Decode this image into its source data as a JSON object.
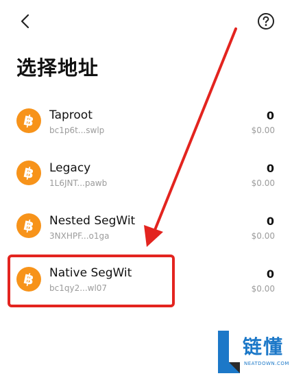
{
  "header": {
    "title": "选择地址"
  },
  "icons": {
    "back": "chevron-left-icon",
    "help": "question-circle-icon",
    "coin": "bitcoin-icon"
  },
  "colors": {
    "bitcoin": "#F7931A",
    "highlight": "#E3241F",
    "watermark": "#1C78C8"
  },
  "addresses": [
    {
      "name": "Taproot",
      "address": "bc1p6t...swlp",
      "balance": "0",
      "fiat": "$0.00"
    },
    {
      "name": "Legacy",
      "address": "1L6JNT...pawb",
      "balance": "0",
      "fiat": "$0.00"
    },
    {
      "name": "Nested SegWit",
      "address": "3NXHPF...o1ga",
      "balance": "0",
      "fiat": "$0.00"
    },
    {
      "name": "Native SegWit",
      "address": "bc1qy2...wl07",
      "balance": "0",
      "fiat": "$0.00"
    }
  ],
  "watermark": {
    "letter": "L",
    "cn": "链懂",
    "en": "NEATDOWN.COM"
  }
}
